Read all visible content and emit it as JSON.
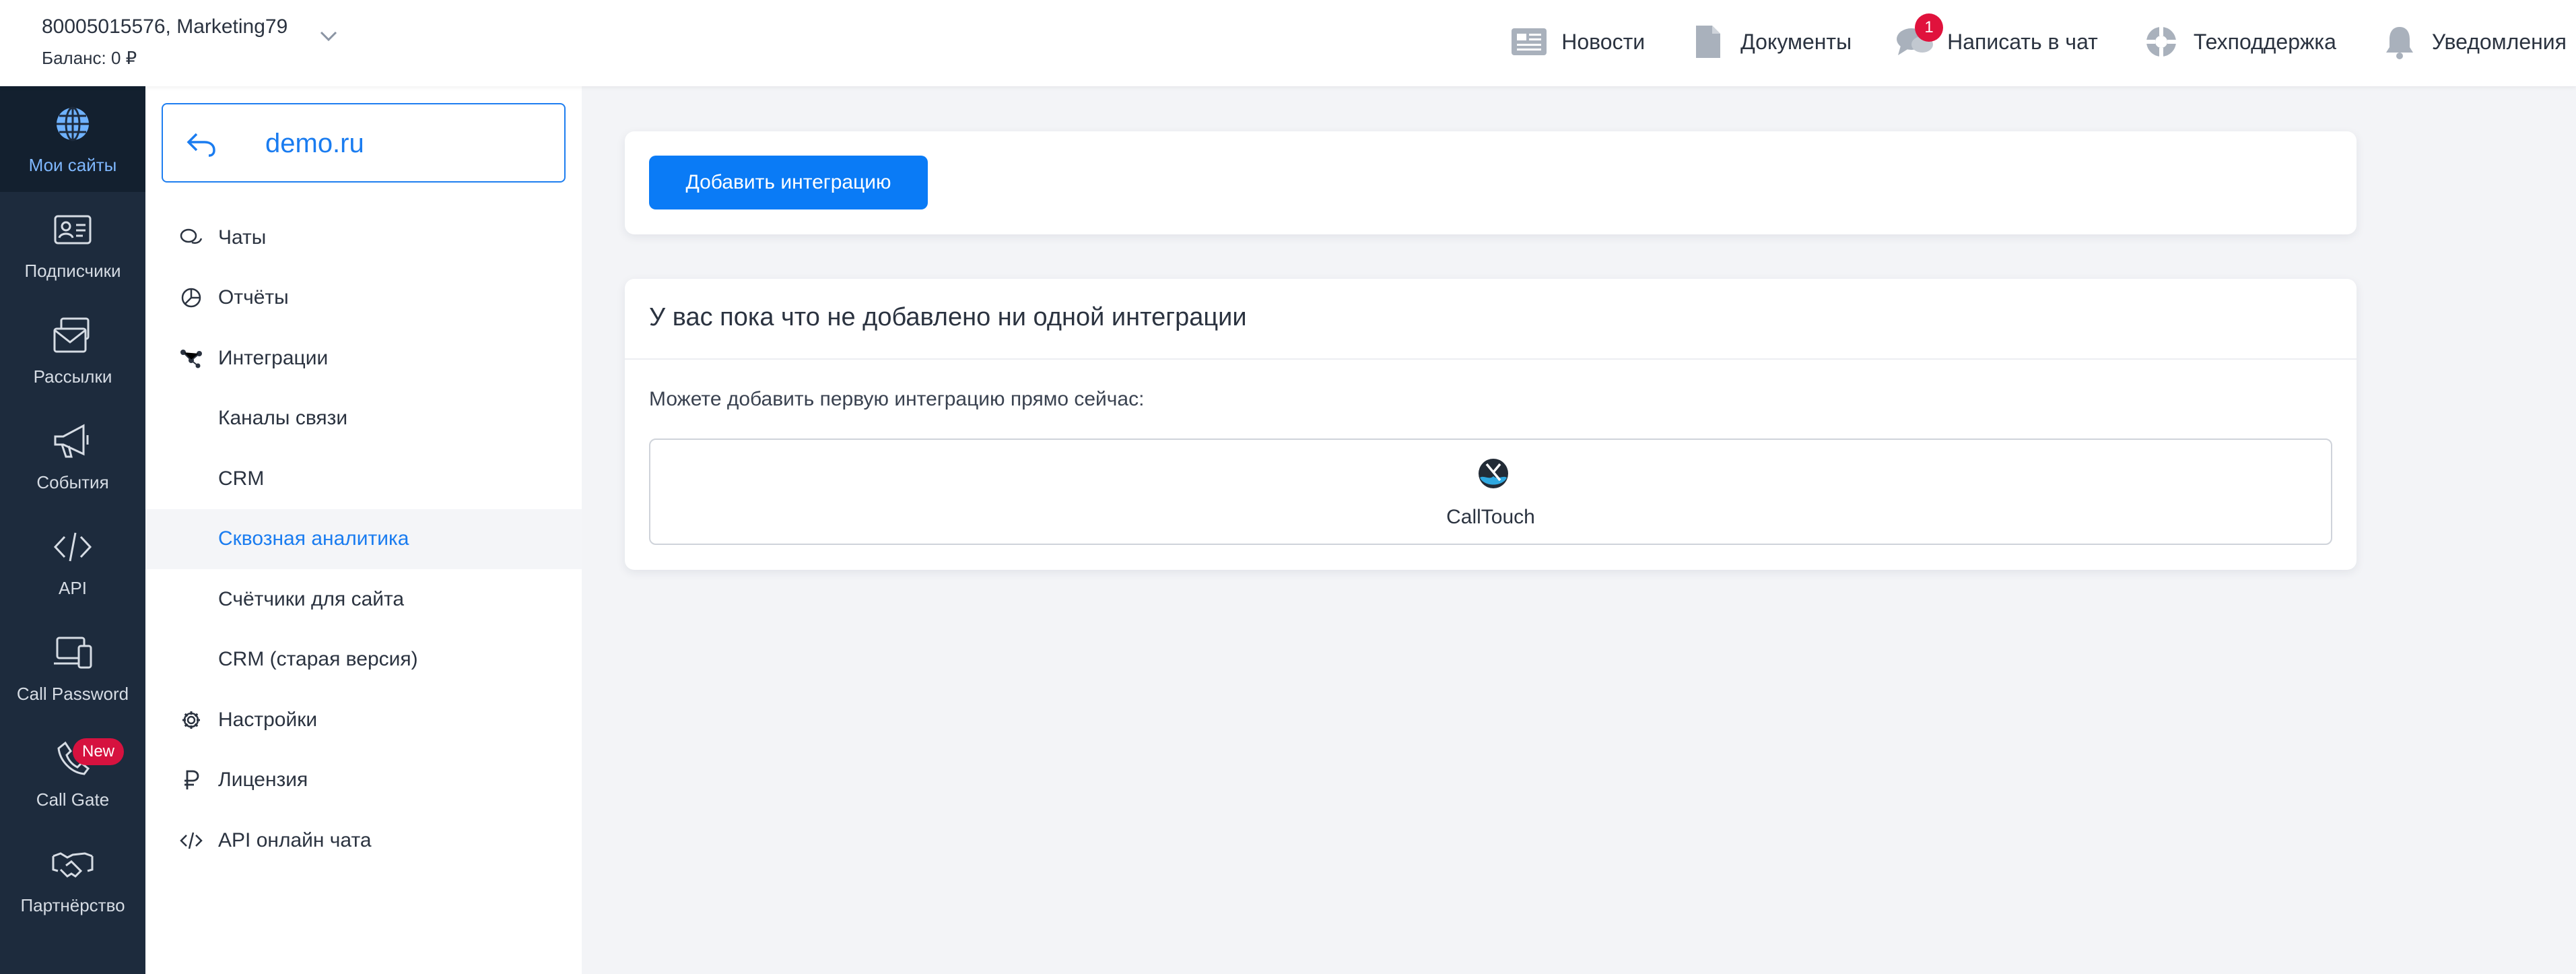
{
  "account": {
    "name": "80005015576, Marketing79",
    "balance": "Баланс: 0 ₽"
  },
  "top_nav": [
    {
      "id": "news",
      "label": "Новости",
      "icon": "newspaper-icon"
    },
    {
      "id": "docs",
      "label": "Документы",
      "icon": "document-icon"
    },
    {
      "id": "chat",
      "label": "Написать в чат",
      "icon": "chat-icon",
      "badge": "1"
    },
    {
      "id": "support",
      "label": "Техподдержка",
      "icon": "lifebuoy-icon"
    },
    {
      "id": "notifications",
      "label": "Уведомления",
      "icon": "bell-icon"
    }
  ],
  "rail": [
    {
      "label": "Мои сайты",
      "icon": "globe-icon",
      "active": true
    },
    {
      "label": "Подписчики",
      "icon": "contact-card-icon"
    },
    {
      "label": "Рассылки",
      "icon": "mail-stack-icon"
    },
    {
      "label": "События",
      "icon": "megaphone-icon"
    },
    {
      "label": "API",
      "icon": "code-icon"
    },
    {
      "label": "Call Password",
      "icon": "devices-icon"
    },
    {
      "label": "Call Gate",
      "icon": "phone-icon",
      "badge": "New"
    },
    {
      "label": "Партнёрство",
      "icon": "handshake-icon"
    }
  ],
  "site": {
    "name": "demo.ru"
  },
  "menu": [
    {
      "label": "Чаты",
      "icon": "chat-bubbles-icon"
    },
    {
      "label": "Отчёты",
      "icon": "pie-chart-icon"
    },
    {
      "label": "Интеграции",
      "icon": "integration-nodes-icon"
    },
    {
      "label": "Каналы связи",
      "sub": true
    },
    {
      "label": "CRM",
      "sub": true
    },
    {
      "label": "Сквозная аналитика",
      "sub": true,
      "active": true
    },
    {
      "label": "Счётчики для сайта",
      "sub": true
    },
    {
      "label": "CRM (старая версия)",
      "sub": true
    },
    {
      "label": "Настройки",
      "icon": "gear-icon"
    },
    {
      "label": "Лицензия",
      "icon": "ruble-icon"
    },
    {
      "label": "API онлайн чата",
      "icon": "code-icon"
    }
  ],
  "main": {
    "add_button": "Добавить интеграцию",
    "empty_title": "У вас пока что не добавлено ни одной интеграции",
    "empty_subtitle": "Можете добавить первую интеграцию прямо сейчас:",
    "integrations": [
      {
        "name": "CallTouch",
        "icon": "calltouch-logo-icon"
      }
    ]
  },
  "colors": {
    "accent": "#0a7bf6",
    "rail_bg": "#1d2b3d",
    "badge": "#e0123c"
  }
}
